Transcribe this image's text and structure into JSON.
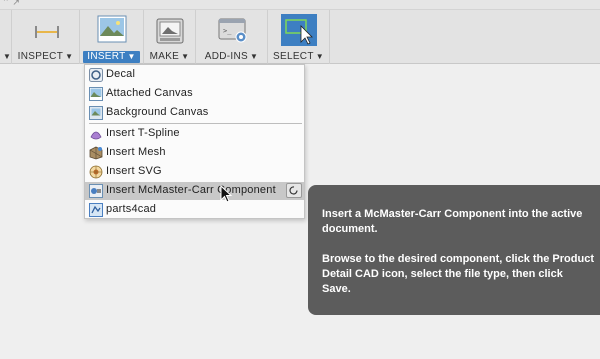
{
  "toolbar": {
    "groups": [
      {
        "label": "INSPECT",
        "icon": "measure-icon"
      },
      {
        "label": "INSERT",
        "icon": "insert-image-icon",
        "active": true
      },
      {
        "label": "MAKE",
        "icon": "3d-print-icon"
      },
      {
        "label": "ADD-INS",
        "icon": "add-ins-icon"
      },
      {
        "label": "SELECT",
        "icon": "select-cursor-icon"
      }
    ]
  },
  "insert_menu": {
    "items": [
      {
        "label": "Decal",
        "icon": "decal-icon"
      },
      {
        "label": "Attached Canvas",
        "icon": "attached-canvas-icon"
      },
      {
        "label": "Background Canvas",
        "icon": "background-canvas-icon"
      },
      {
        "label": "Insert T-Spline",
        "icon": "t-spline-icon"
      },
      {
        "label": "Insert Mesh",
        "icon": "mesh-icon"
      },
      {
        "label": "Insert SVG",
        "icon": "svg-icon"
      },
      {
        "label": "Insert McMaster-Carr Component",
        "icon": "mcmaster-icon",
        "hover": true
      },
      {
        "label": "parts4cad",
        "icon": "parts4cad-icon"
      }
    ]
  },
  "tooltip": {
    "line1": "Insert a McMaster-Carr Component into the active document.",
    "line2": "Browse to the desired component, click the Product Detail CAD icon, select the file type, then click Save."
  },
  "colors": {
    "active_label_bg": "#3d7fc2",
    "tooltip_bg": "#5c5c5c",
    "menu_hover": "#c8c8c8"
  }
}
